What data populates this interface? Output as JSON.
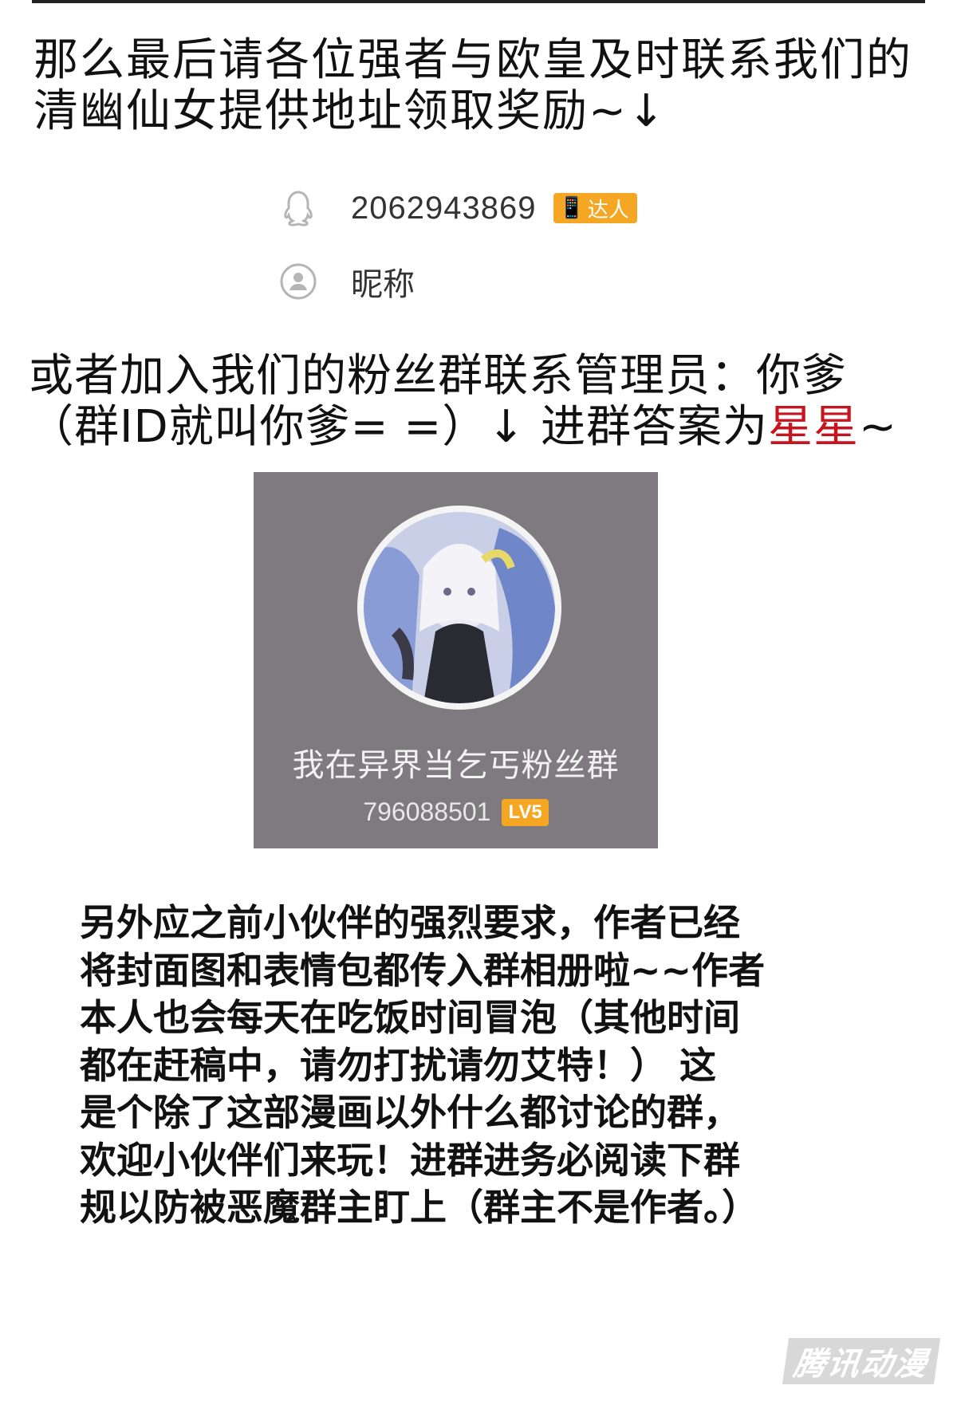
{
  "intro": {
    "line1": "那么最后请各位强者与欧皇及时联系我们的",
    "line2": "清幽仙女提供地址领取奖励~↓"
  },
  "qq_contact": {
    "number": "2062943869",
    "badge": "达人",
    "nickname": "昵称"
  },
  "fan_group_text": {
    "line1": "或者加入我们的粉丝群联系管理员：你爹",
    "line2_prefix": "（群ID就叫你爹= =）↓ 进群答案为",
    "answer": "星星",
    "line2_suffix": "~",
    "answer_color": "#c8141e"
  },
  "group_card": {
    "name": "我在异界当乞丐粉丝群",
    "group_id": "796088501",
    "level": "LV5",
    "background": "#7e7a7f"
  },
  "notice_lines": [
    "另外应之前小伙伴的强烈要求，作者已经",
    "将封面图和表情包都传入群相册啦~~作者",
    "本人也会每天在吃饭时间冒泡（其他时间",
    "都在赶稿中，请勿打扰请勿艾特！） 这",
    "是个除了这部漫画以外什么都讨论的群，",
    "欢迎小伙伴们来玩！进群进务必阅读下群",
    "规以防被恶魔群主盯上（群主不是作者。）"
  ],
  "watermark": "腾讯动漫",
  "icons": {
    "qq": "qq-penguin-icon",
    "nickname": "person-icon",
    "badge": "wings-phone-icon"
  }
}
